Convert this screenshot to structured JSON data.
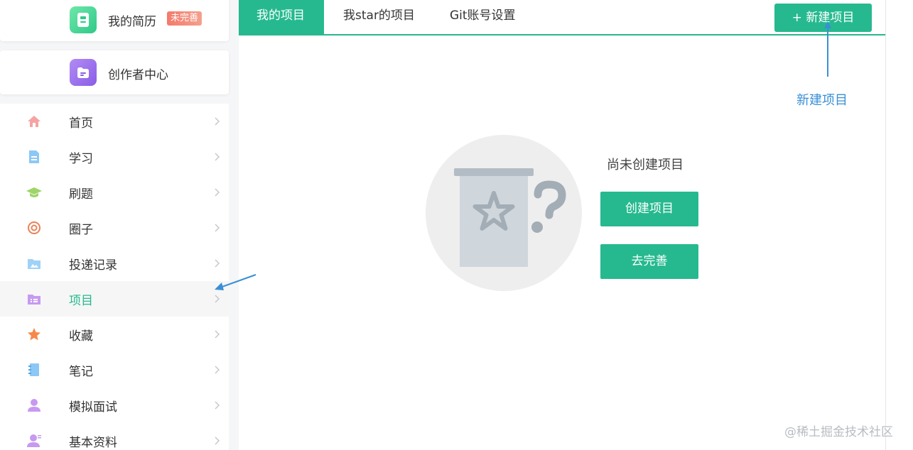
{
  "sidebar": {
    "resume": {
      "label": "我的简历",
      "badge": "未完善"
    },
    "creator": {
      "label": "创作者中心"
    },
    "menu": [
      {
        "label": "首页",
        "icon": "home-icon"
      },
      {
        "label": "学习",
        "icon": "document-icon"
      },
      {
        "label": "刷题",
        "icon": "graduation-cap-icon"
      },
      {
        "label": "圈子",
        "icon": "target-icon"
      },
      {
        "label": "投递记录",
        "icon": "folder-icon"
      },
      {
        "label": "项目",
        "icon": "project-folder-icon",
        "active": true
      },
      {
        "label": "收藏",
        "icon": "star-icon"
      },
      {
        "label": "笔记",
        "icon": "notebook-icon"
      },
      {
        "label": "模拟面试",
        "icon": "user-icon"
      },
      {
        "label": "基本资料",
        "icon": "profile-icon"
      }
    ]
  },
  "tabs": [
    {
      "label": "我的项目",
      "active": true
    },
    {
      "label": "我star的项目"
    },
    {
      "label": "Git账号设置"
    }
  ],
  "new_project_button": "+ 新建项目",
  "empty": {
    "message": "尚未创建项目",
    "create_button": "创建项目",
    "complete_button": "去完善"
  },
  "annotation": "新建项目",
  "watermark": "@稀土掘金技术社区",
  "colors": {
    "accent": "#26b98f",
    "annotation": "#3a8fd6"
  }
}
